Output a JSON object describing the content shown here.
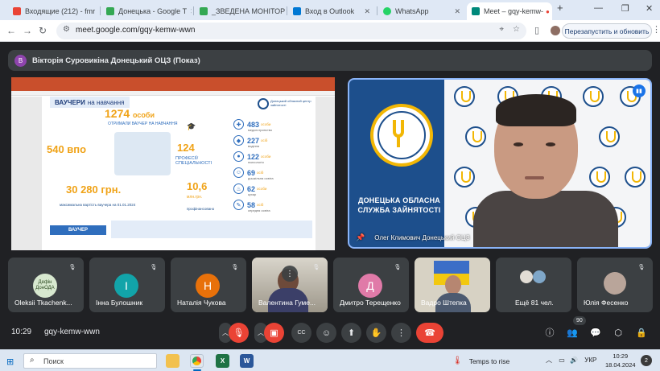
{
  "browser": {
    "tabs": [
      {
        "label": "Входящие (212) - fmr",
        "color": "#ea4335"
      },
      {
        "label": "Донецька - Google Т",
        "color": "#34a853"
      },
      {
        "label": "_ЗВЕДЕНА МОНІТОР",
        "color": "#34a853"
      },
      {
        "label": "Вход в Outlook",
        "color": "#0078d4"
      },
      {
        "label": "WhatsApp",
        "color": "#25d366"
      },
      {
        "label": "Meet – gqy-kemw-",
        "color": "#00897b"
      }
    ],
    "new_tab": "+",
    "url": "meet.google.com/gqy-kemw-wwn",
    "relaunch_label": "Перезапустить и обновить"
  },
  "meet": {
    "presenter_label": "Вікторія Суровикіна Донецький ОЦЗ (Показ)",
    "presenter_initial": "В",
    "slide": {
      "heading_bold": "ВАУЧЕРИ",
      "heading_rest": "на навчання",
      "org_caption": "Донецький обласний центр зайнятості",
      "persons_count": "1274",
      "persons_unit": "особи",
      "persons_caption": "ОТРИМАЛИ ВАУЧЕР НА НАВЧАННЯ",
      "vpo_count": "540 впо",
      "professions_count": "124",
      "professions_caption": "ПРОФЕСІЇ/ СПЕЦІАЛЬНОСТІ",
      "amount": "30 280 грн.",
      "amount_caption": "максимальна вартість ваучера на 01.01.2024",
      "million": "10,6",
      "million_unit": "млн.грн.",
      "million_caption": "профінансовано",
      "stats": [
        {
          "num": "483",
          "unit": "особи",
          "desc": "медсестринство"
        },
        {
          "num": "227",
          "unit": "осіб",
          "desc": "водіння"
        },
        {
          "num": "122",
          "unit": "особи",
          "desc": "психологія"
        },
        {
          "num": "69",
          "unit": "осіб",
          "desc": "дошкільна освіта"
        },
        {
          "num": "62",
          "unit": "особи",
          "desc": "кухар"
        },
        {
          "num": "58",
          "unit": "осіб",
          "desc": "середня освіта"
        }
      ],
      "footer_tag": "ВАУЧЕР"
    },
    "speaker": {
      "name": "Олег Климович Донецький ОЦЗ",
      "org_name": "ДОНЕЦЬКА ОБЛАСНА СЛУЖБА ЗАЙНЯТОСТІ"
    },
    "participants": [
      {
        "name": "Oleksii Tkachenk...",
        "initial": "Дефін ДонОДА",
        "color": "#d7e8cf"
      },
      {
        "name": "Інна Булошник",
        "initial": "І",
        "color": "#12a4a9"
      },
      {
        "name": "Наталія Чукова",
        "initial": "Н",
        "color": "#e8710a"
      },
      {
        "name": "Валентина Гуме...",
        "initial": "",
        "color": "#6e6a60"
      },
      {
        "name": "Дмитро Терещенко",
        "initial": "Д",
        "color": "#e07aa8"
      },
      {
        "name": "Вадро Штепка",
        "initial": "",
        "color": "#6a86a8"
      },
      {
        "name": "Ещё 81 чел.",
        "initial": "",
        "color": "#3c4043"
      },
      {
        "name": "Юлія Фесенко",
        "initial": "",
        "color": "#3c4043"
      }
    ],
    "time": "10:29",
    "meeting_code": "gqy-kemw-wwn",
    "people_count": "90"
  },
  "taskbar": {
    "search_placeholder": "Поиск",
    "weather": "Temps to rise",
    "lang": "УКР",
    "time": "10:29",
    "date": "18.04.2024",
    "notifications": "2"
  }
}
